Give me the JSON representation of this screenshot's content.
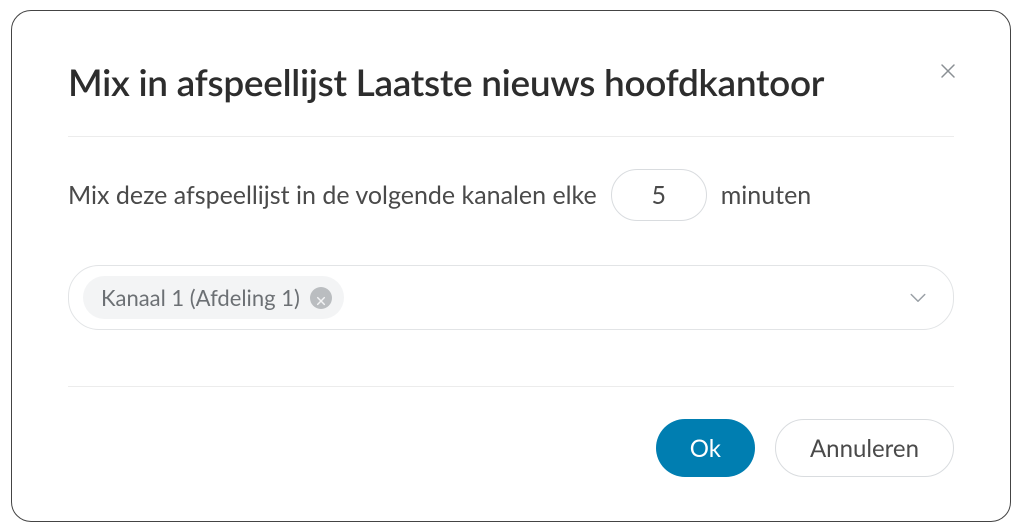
{
  "dialog": {
    "title": "Mix in afspeellijst Laatste nieuws hoofdkantoor",
    "close_icon": "close"
  },
  "interval": {
    "prefix": "Mix deze afspeellijst in de volgende kanalen elke",
    "value": "5",
    "suffix": "minuten"
  },
  "channels": {
    "selected": [
      {
        "label": "Kanaal 1 (Afdeling 1)"
      }
    ]
  },
  "footer": {
    "ok_label": "Ok",
    "cancel_label": "Annuleren"
  }
}
